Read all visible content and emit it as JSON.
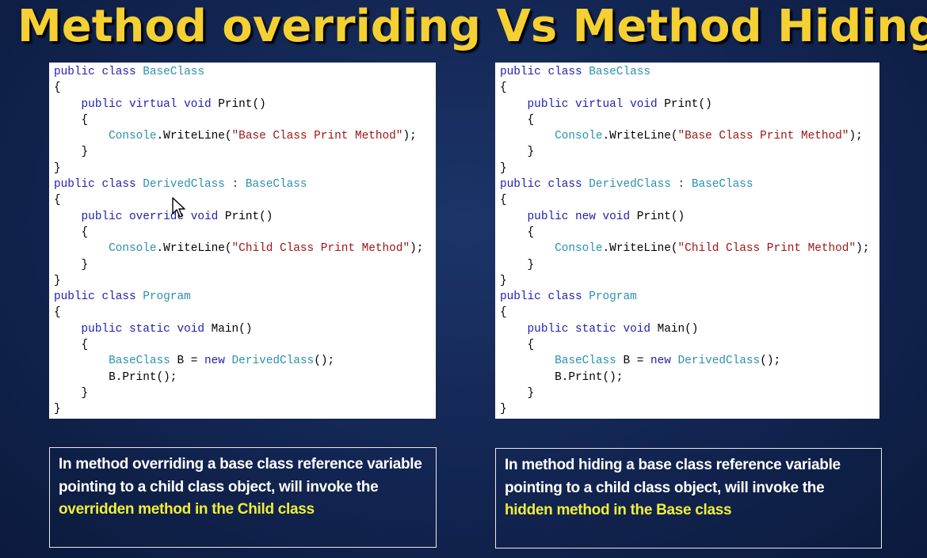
{
  "slide": {
    "title": "Method overriding Vs Method Hiding"
  },
  "left_panel": {
    "code": [
      [
        [
          "kw",
          "public class "
        ],
        [
          "ty",
          "BaseClass"
        ]
      ],
      [
        [
          "",
          "{"
        ]
      ],
      [
        [
          "kw",
          "    public virtual void "
        ],
        [
          "",
          "Print()"
        ]
      ],
      [
        [
          "",
          "    {"
        ]
      ],
      [
        [
          "ty",
          "        Console"
        ],
        [
          "",
          ".WriteLine("
        ],
        [
          "st",
          "\"Base Class Print Method\""
        ],
        [
          "",
          ");"
        ]
      ],
      [
        [
          "",
          "    }"
        ]
      ],
      [
        [
          "",
          "}"
        ]
      ],
      [
        [
          "kw",
          "public class "
        ],
        [
          "ty",
          "DerivedClass"
        ],
        [
          "kw",
          " : "
        ],
        [
          "ty",
          "BaseClass"
        ]
      ],
      [
        [
          "",
          "{"
        ]
      ],
      [
        [
          "kw",
          "    public override void "
        ],
        [
          "",
          "Print()"
        ]
      ],
      [
        [
          "",
          "    {"
        ]
      ],
      [
        [
          "ty",
          "        Console"
        ],
        [
          "",
          ".WriteLine("
        ],
        [
          "st",
          "\"Child Class Print Method\""
        ],
        [
          "",
          ");"
        ]
      ],
      [
        [
          "",
          "    }"
        ]
      ],
      [
        [
          "",
          "}"
        ]
      ],
      [
        [
          "kw",
          "public class "
        ],
        [
          "ty",
          "Program"
        ]
      ],
      [
        [
          "",
          "{"
        ]
      ],
      [
        [
          "kw",
          "    public static void "
        ],
        [
          "",
          "Main()"
        ]
      ],
      [
        [
          "",
          "    {"
        ]
      ],
      [
        [
          "ty",
          "        BaseClass"
        ],
        [
          "",
          " B = "
        ],
        [
          "kw",
          "new "
        ],
        [
          "ty",
          "DerivedClass"
        ],
        [
          "",
          "();"
        ]
      ],
      [
        [
          "",
          "        B.Print();"
        ]
      ],
      [
        [
          "",
          "    }"
        ]
      ],
      [
        [
          "",
          "}"
        ]
      ]
    ],
    "note": [
      [
        "",
        "In method overriding a base class reference variable pointing to a child class object, will invoke the "
      ],
      [
        "hl",
        "overridden method in the Child class"
      ]
    ]
  },
  "right_panel": {
    "code": [
      [
        [
          "kw",
          "public class "
        ],
        [
          "ty",
          "BaseClass"
        ]
      ],
      [
        [
          "",
          "{"
        ]
      ],
      [
        [
          "kw",
          "    public virtual void "
        ],
        [
          "",
          "Print()"
        ]
      ],
      [
        [
          "",
          "    {"
        ]
      ],
      [
        [
          "ty",
          "        Console"
        ],
        [
          "",
          ".WriteLine("
        ],
        [
          "st",
          "\"Base Class Print Method\""
        ],
        [
          "",
          ");"
        ]
      ],
      [
        [
          "",
          "    }"
        ]
      ],
      [
        [
          "",
          "}"
        ]
      ],
      [
        [
          "kw",
          "public class "
        ],
        [
          "ty",
          "DerivedClass"
        ],
        [
          "kw",
          " : "
        ],
        [
          "ty",
          "BaseClass"
        ]
      ],
      [
        [
          "",
          "{"
        ]
      ],
      [
        [
          "kw",
          "    public new void "
        ],
        [
          "",
          "Print()"
        ]
      ],
      [
        [
          "",
          "    {"
        ]
      ],
      [
        [
          "ty",
          "        Console"
        ],
        [
          "",
          ".WriteLine("
        ],
        [
          "st",
          "\"Child Class Print Method\""
        ],
        [
          "",
          ");"
        ]
      ],
      [
        [
          "",
          "    }"
        ]
      ],
      [
        [
          "",
          "}"
        ]
      ],
      [
        [
          "kw",
          "public class "
        ],
        [
          "ty",
          "Program"
        ]
      ],
      [
        [
          "",
          "{"
        ]
      ],
      [
        [
          "kw",
          "    public static void "
        ],
        [
          "",
          "Main()"
        ]
      ],
      [
        [
          "",
          "    {"
        ]
      ],
      [
        [
          "ty",
          "        BaseClass"
        ],
        [
          "",
          " B = "
        ],
        [
          "kw",
          "new "
        ],
        [
          "ty",
          "DerivedClass"
        ],
        [
          "",
          "();"
        ]
      ],
      [
        [
          "",
          "        B.Print();"
        ]
      ],
      [
        [
          "",
          "    }"
        ]
      ],
      [
        [
          "",
          "}"
        ]
      ]
    ],
    "note": [
      [
        "",
        "In method hiding a base class reference variable pointing to a child class object, will invoke the "
      ],
      [
        "hl",
        "hidden method in the Base class"
      ]
    ]
  },
  "icons": {
    "cursor": "mouse-pointer-icon"
  }
}
